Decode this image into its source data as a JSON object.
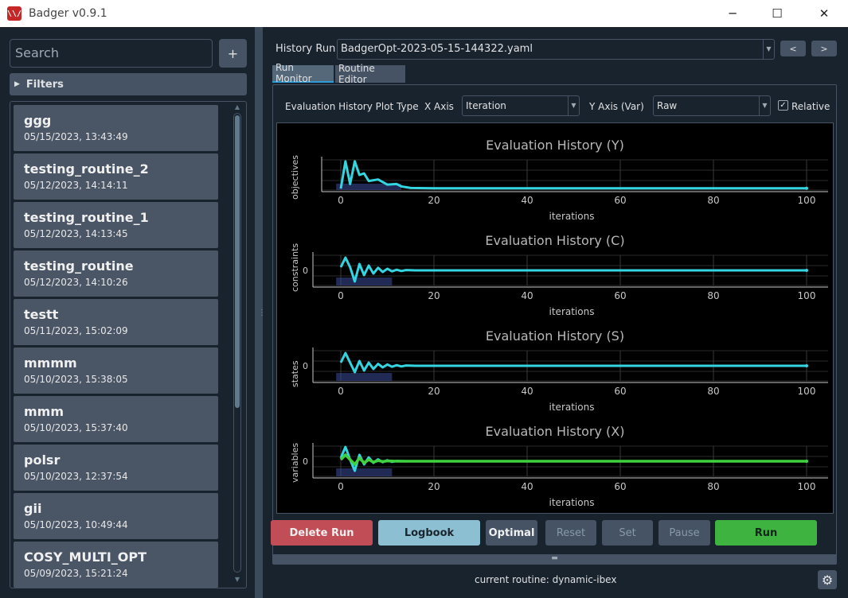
{
  "window": {
    "title": "Badger v0.9.1",
    "icon": "badger-logo-icon",
    "controls": [
      "─",
      "☐",
      "✕"
    ]
  },
  "sidebar": {
    "search_placeholder": "Search",
    "add_label": "+",
    "filters_label": "Filters",
    "routines": [
      {
        "name": "ggg",
        "date": "05/15/2023, 13:43:49"
      },
      {
        "name": "testing_routine_2",
        "date": "05/12/2023, 14:14:11"
      },
      {
        "name": "testing_routine_1",
        "date": "05/12/2023, 14:13:45"
      },
      {
        "name": "testing_routine",
        "date": "05/12/2023, 14:10:26"
      },
      {
        "name": "testt",
        "date": "05/11/2023, 15:02:09"
      },
      {
        "name": "mmmm",
        "date": "05/10/2023, 15:38:05"
      },
      {
        "name": "mmm",
        "date": "05/10/2023, 15:37:40"
      },
      {
        "name": "polsr",
        "date": "05/10/2023, 12:37:54"
      },
      {
        "name": "gii",
        "date": "05/10/2023, 10:49:44"
      },
      {
        "name": "COSY_MULTI_OPT",
        "date": "05/09/2023, 15:21:24"
      }
    ]
  },
  "history": {
    "label": "History Run",
    "value": "BadgerOpt-2023-05-15-144322.yaml",
    "prev_label": "<",
    "next_label": ">"
  },
  "tabs": {
    "run_monitor": "Run Monitor",
    "routine_editor": "Routine Editor"
  },
  "plot_controls": {
    "plot_type_label": "Evaluation History Plot Type",
    "x_axis_label": "X Axis",
    "x_axis_value": "Iteration",
    "y_axis_label": "Y Axis (Var)",
    "y_axis_value": "Raw",
    "relative_label": "Relative",
    "relative_checked": "✓"
  },
  "chart_data": [
    {
      "type": "line",
      "title": "Evaluation History (Y)",
      "xlabel": "iterations",
      "ylabel": "objectives",
      "xlim": [
        0,
        100
      ],
      "xticks": [
        "0",
        "20",
        "40",
        "60",
        "80",
        "100"
      ],
      "yticks": [],
      "series": [
        {
          "color": "#33d6e0",
          "x": [
            0,
            1,
            2,
            3,
            4,
            5,
            6,
            8,
            10,
            12,
            13,
            15,
            20,
            40,
            60,
            80,
            100
          ],
          "y": [
            0.05,
            0.95,
            0.2,
            0.95,
            0.5,
            0.55,
            0.3,
            0.35,
            0.18,
            0.2,
            0.12,
            0.07,
            0.06,
            0.06,
            0.06,
            0.06,
            0.06
          ]
        }
      ]
    },
    {
      "type": "line",
      "title": "Evaluation History (C)",
      "xlabel": "iterations",
      "ylabel": "constraints",
      "xlim": [
        0,
        100
      ],
      "xticks": [
        "0",
        "20",
        "40",
        "60",
        "80",
        "100"
      ],
      "yticks": [
        "0"
      ],
      "series": [
        {
          "color": "#33d6e0",
          "x": [
            0,
            1,
            2,
            3,
            4,
            5,
            6,
            7,
            8,
            9,
            10,
            11,
            12,
            13,
            14,
            16,
            18,
            100
          ],
          "y": [
            0.1,
            0.4,
            0.1,
            -0.35,
            0.2,
            -0.15,
            0.15,
            -0.1,
            0.08,
            -0.05,
            0.05,
            -0.03,
            0.02,
            -0.02,
            0.01,
            0.0,
            0.0,
            0.0
          ]
        }
      ]
    },
    {
      "type": "line",
      "title": "Evaluation History (S)",
      "xlabel": "iterations",
      "ylabel": "states",
      "xlim": [
        0,
        100
      ],
      "xticks": [
        "0",
        "20",
        "40",
        "60",
        "80",
        "100"
      ],
      "yticks": [
        "0"
      ],
      "series": [
        {
          "color": "#33d6e0",
          "x": [
            0,
            1,
            2,
            3,
            4,
            5,
            6,
            7,
            8,
            9,
            10,
            11,
            12,
            13,
            14,
            16,
            18,
            100
          ],
          "y": [
            0.1,
            0.4,
            0.1,
            -0.2,
            0.15,
            -0.15,
            0.1,
            -0.1,
            0.06,
            -0.05,
            0.04,
            -0.03,
            0.02,
            -0.02,
            0.01,
            0.0,
            0.0,
            0.0
          ]
        }
      ]
    },
    {
      "type": "line",
      "title": "Evaluation History (X)",
      "xlabel": "iterations",
      "ylabel": "variables",
      "xlim": [
        0,
        100
      ],
      "xticks": [
        "0",
        "20",
        "40",
        "60",
        "80",
        "100"
      ],
      "yticks": [
        "0"
      ],
      "series": [
        {
          "color": "#33d6e0",
          "x": [
            0,
            1,
            2,
            3,
            4,
            5,
            6,
            7,
            8,
            9,
            10,
            11,
            12,
            14,
            16,
            100
          ],
          "y": [
            0.1,
            0.45,
            0.05,
            -0.3,
            0.2,
            -0.1,
            0.12,
            -0.05,
            0.06,
            -0.03,
            0.03,
            -0.02,
            0.01,
            0.0,
            0.0,
            0.0
          ]
        },
        {
          "color": "#3fd13f",
          "x": [
            0,
            1,
            2,
            3,
            4,
            5,
            6,
            7,
            8,
            9,
            10,
            12,
            14,
            100
          ],
          "y": [
            0.05,
            0.2,
            0.05,
            -0.1,
            0.1,
            -0.05,
            0.05,
            -0.03,
            0.02,
            -0.01,
            0.01,
            0.0,
            0.0,
            0.0
          ]
        }
      ]
    }
  ],
  "actions": {
    "delete": "Delete Run",
    "logbook": "Logbook",
    "optimal": "Optimal",
    "reset": "Reset",
    "set": "Set",
    "pause": "Pause",
    "run": "Run"
  },
  "status": {
    "current_routine": "current routine: dynamic-ibex"
  }
}
